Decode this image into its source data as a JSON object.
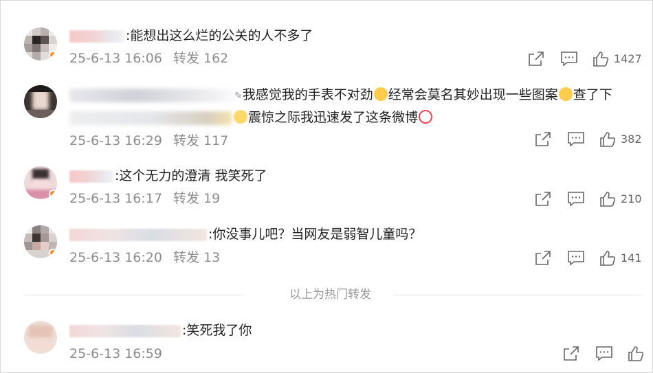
{
  "comments": [
    {
      "text": ":能想出这么烂的公关的人不多了",
      "time": "25-6-13 16:06",
      "repost_label": "转发 162",
      "likes": "1427"
    },
    {
      "text_line1": "我感觉我的手表不对劲",
      "text_mid": "经常会莫名其妙出现一些图案",
      "text_end": "查了下",
      "text_line2": "震惊之际我迅速发了这条微博",
      "time": "25-6-13 16:29",
      "repost_label": "转发 117",
      "likes": "382"
    },
    {
      "text": ":这个无力的澄清 我笑死了",
      "time": "25-6-13 16:17",
      "repost_label": "转发 19",
      "likes": "210"
    },
    {
      "text": ":你没事儿吧？当网友是弱智儿童吗？",
      "time": "25-6-13 16:20",
      "repost_label": "转发 13",
      "likes": "141"
    },
    {
      "text": ":笑死我了你",
      "time": "25-6-13 16:59",
      "repost_label": "",
      "likes": ""
    }
  ],
  "divider": {
    "label": "以上为热门转发"
  },
  "icons": {
    "share": "share-icon",
    "comment": "comment-icon",
    "like": "thumbs-up-icon",
    "emoji_sweat": "persevering-face-emoji",
    "emoji_kiss": "face-blowing-kiss-emoji",
    "emoji_fear": "screaming-face-emoji",
    "emoji_clown": "clown-face-emoji"
  },
  "colors": {
    "meta_text": "#8c8c8c",
    "badge": "#ff8a1f",
    "icon": "#666666"
  }
}
